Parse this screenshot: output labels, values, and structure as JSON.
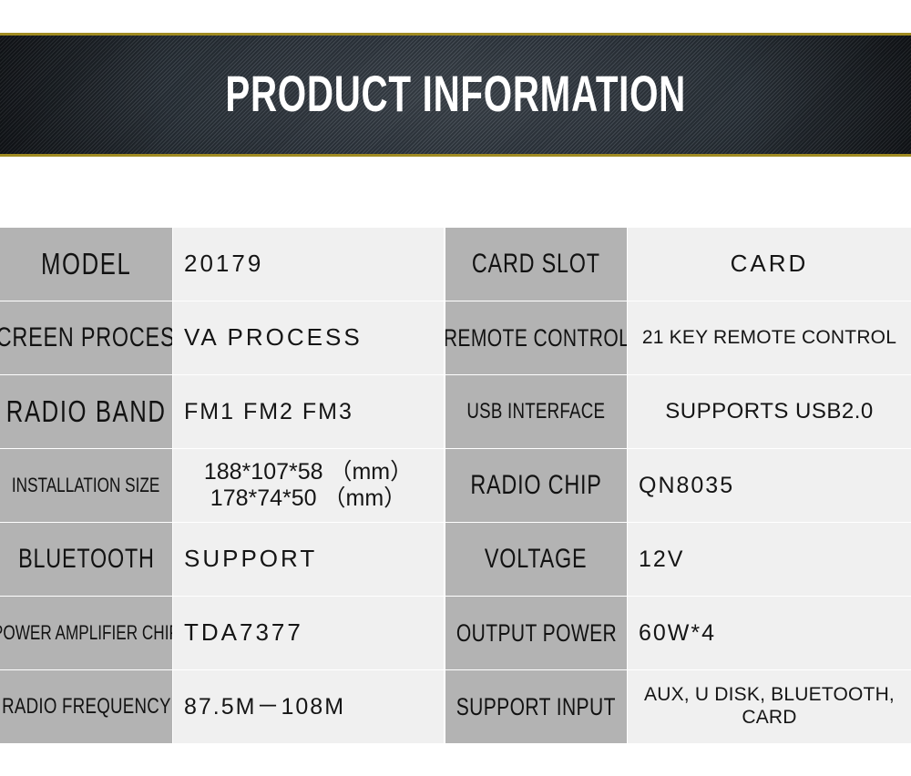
{
  "banner": {
    "title": "PRODUCT INFORMATION",
    "border_color": "#a08b21",
    "background_color": "#252b31",
    "title_color": "#ffffff",
    "texture": "carbon-fiber-diagonal"
  },
  "table": {
    "label_bg": "#b3b3b3",
    "value_bg": "#f0f0f0",
    "text_color": "#151515",
    "rows": [
      {
        "left_label": "MODEL",
        "left_value": "20179",
        "right_label": "CARD SLOT",
        "right_value": "CARD"
      },
      {
        "left_label": "SCREEN PROCESS",
        "left_value": "VA PROCESS",
        "right_label": "REMOTE CONTROL",
        "right_value": "21 KEY REMOTE CONTROL"
      },
      {
        "left_label": "RADIO BAND",
        "left_value": "FM1 FM2 FM3",
        "right_label": "USB INTERFACE",
        "right_value": "SUPPORTS USB2.0"
      },
      {
        "left_label": "INSTALLATION SIZE",
        "left_value_line1": "188*107*58 （mm）",
        "left_value_line2": "178*74*50  （mm）",
        "right_label": "RADIO CHIP",
        "right_value": "QN8035"
      },
      {
        "left_label": "BLUETOOTH",
        "left_value": "SUPPORT",
        "right_label": "VOLTAGE",
        "right_value": "12V"
      },
      {
        "left_label": "POWER AMPLIFIER CHIP",
        "left_value": "TDA7377",
        "right_label": "OUTPUT POWER",
        "right_value": "60W*4"
      },
      {
        "left_label": "RADIO FREQUENCY",
        "left_value": "87.5M－108M",
        "right_label": "SUPPORT INPUT",
        "right_value_line1": "AUX, U DISK, BLUETOOTH,",
        "right_value_line2": "CARD"
      }
    ]
  }
}
